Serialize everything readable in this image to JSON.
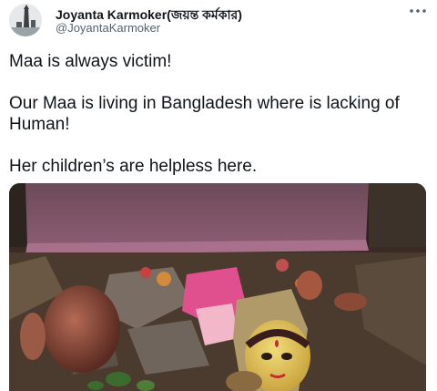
{
  "user": {
    "name": "Joyanta Karmoker(জয়ন্ত কর্মকার)",
    "handle": "@JoyantaKarmoker"
  },
  "more_icon": "more-horizontal-icon",
  "tweet": {
    "paragraphs": [
      "Maa is always victim!",
      "Our Maa is living in Bangladesh where is lacking of Human!",
      "Her children’s are helpless here."
    ]
  },
  "media": {
    "image": "photo-of-broken-idol"
  }
}
